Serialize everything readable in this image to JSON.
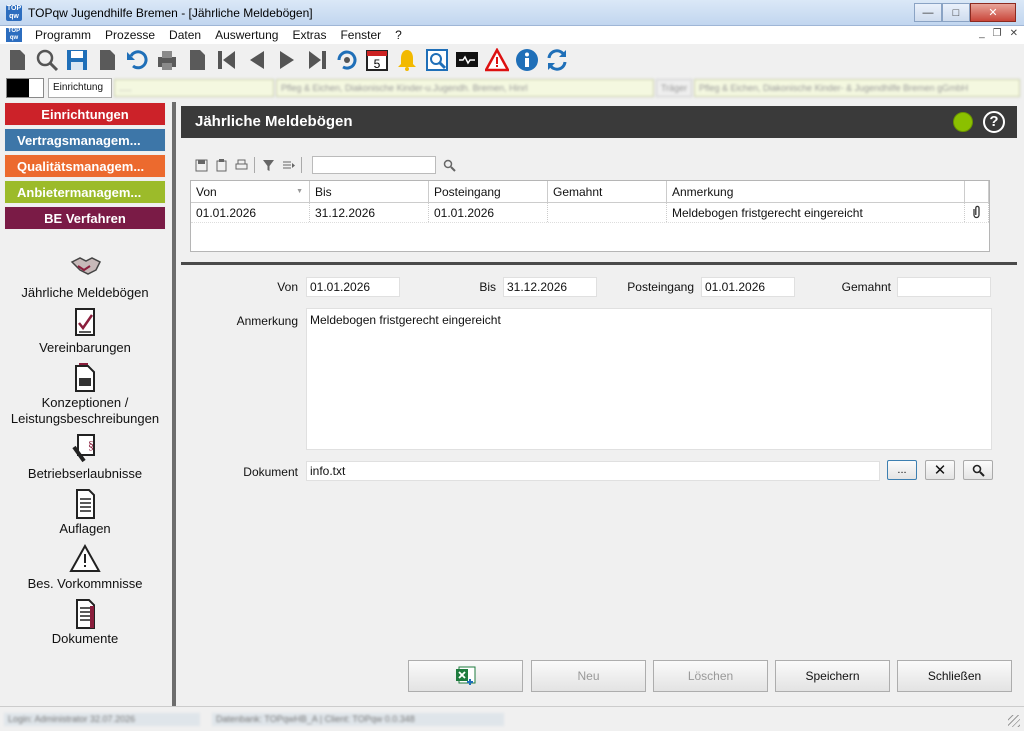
{
  "window": {
    "title": "TOPqw Jugendhilfe Bremen - [Jährliche Meldebögen]",
    "minimize": "—",
    "maximize": "□",
    "close": "✕"
  },
  "menu": [
    "Programm",
    "Prozesse",
    "Daten",
    "Auswertung",
    "Extras",
    "Fenster",
    "?"
  ],
  "infobar": {
    "einrichtung_label": "Einrichtung",
    "blur1": ".....",
    "blur2": "Pfleg & Eichen, Diakonische Kinder-u.Jugendh. Bremen, Hinrl",
    "blur3": "Träger",
    "blur4": "Pfleg & Eichen, Diakonische Kinder- & Jugendhilfe Bremen gGmbH"
  },
  "sidebar": {
    "categories": [
      {
        "label": "Einrichtungen",
        "color": "#cc2229"
      },
      {
        "label": "Vertragsmanagem...",
        "color": "#3d76a8"
      },
      {
        "label": "Qualitätsmanagem...",
        "color": "#ec6a2e"
      },
      {
        "label": "Anbietermanagem...",
        "color": "#9cbb2a"
      },
      {
        "label": "BE Verfahren",
        "color": "#7a1b46"
      }
    ],
    "items": [
      {
        "label": "Jährliche Meldebögen",
        "icon": "handshake-icon"
      },
      {
        "label": "Vereinbarungen",
        "icon": "contract-icon"
      },
      {
        "label": "Konzeptionen / Leistungsbeschreibungen",
        "icon": "concept-icon"
      },
      {
        "label": "Betriebserlaubnisse",
        "icon": "permit-icon"
      },
      {
        "label": "Auflagen",
        "icon": "list-icon"
      },
      {
        "label": "Bes. Vorkommnisse",
        "icon": "warning-icon"
      },
      {
        "label": "Dokumente",
        "icon": "documents-icon"
      }
    ]
  },
  "main": {
    "title": "Jährliche Meldebögen",
    "help": "?",
    "grid": {
      "columns": [
        "Von",
        "Bis",
        "Posteingang",
        "Gemahnt",
        "Anmerkung"
      ],
      "rows": [
        {
          "von": "01.01.2026",
          "bis": "31.12.2026",
          "posteingang": "01.01.2026",
          "gemahnt": "",
          "anmerkung": "Meldebogen fristgerecht eingereicht"
        }
      ]
    },
    "form": {
      "von_label": "Von",
      "von_value": "01.01.2026",
      "bis_label": "Bis",
      "bis_value": "31.12.2026",
      "posteingang_label": "Posteingang",
      "posteingang_value": "01.01.2026",
      "gemahnt_label": "Gemahnt",
      "gemahnt_value": "",
      "anmerkung_label": "Anmerkung",
      "anmerkung_value": "Meldebogen fristgerecht eingereicht",
      "dokument_label": "Dokument",
      "dokument_value": "info.txt",
      "browse": "...",
      "clear": "✕"
    },
    "buttons": {
      "neu": "Neu",
      "loeschen": "Löschen",
      "speichern": "Speichern",
      "schliessen": "Schließen"
    }
  },
  "statusbar": {
    "login": "Login: Administrator 32.07.2026",
    "db": "Datenbank: TOPqwHB_A | Client: TOPqw 0.0.348"
  }
}
